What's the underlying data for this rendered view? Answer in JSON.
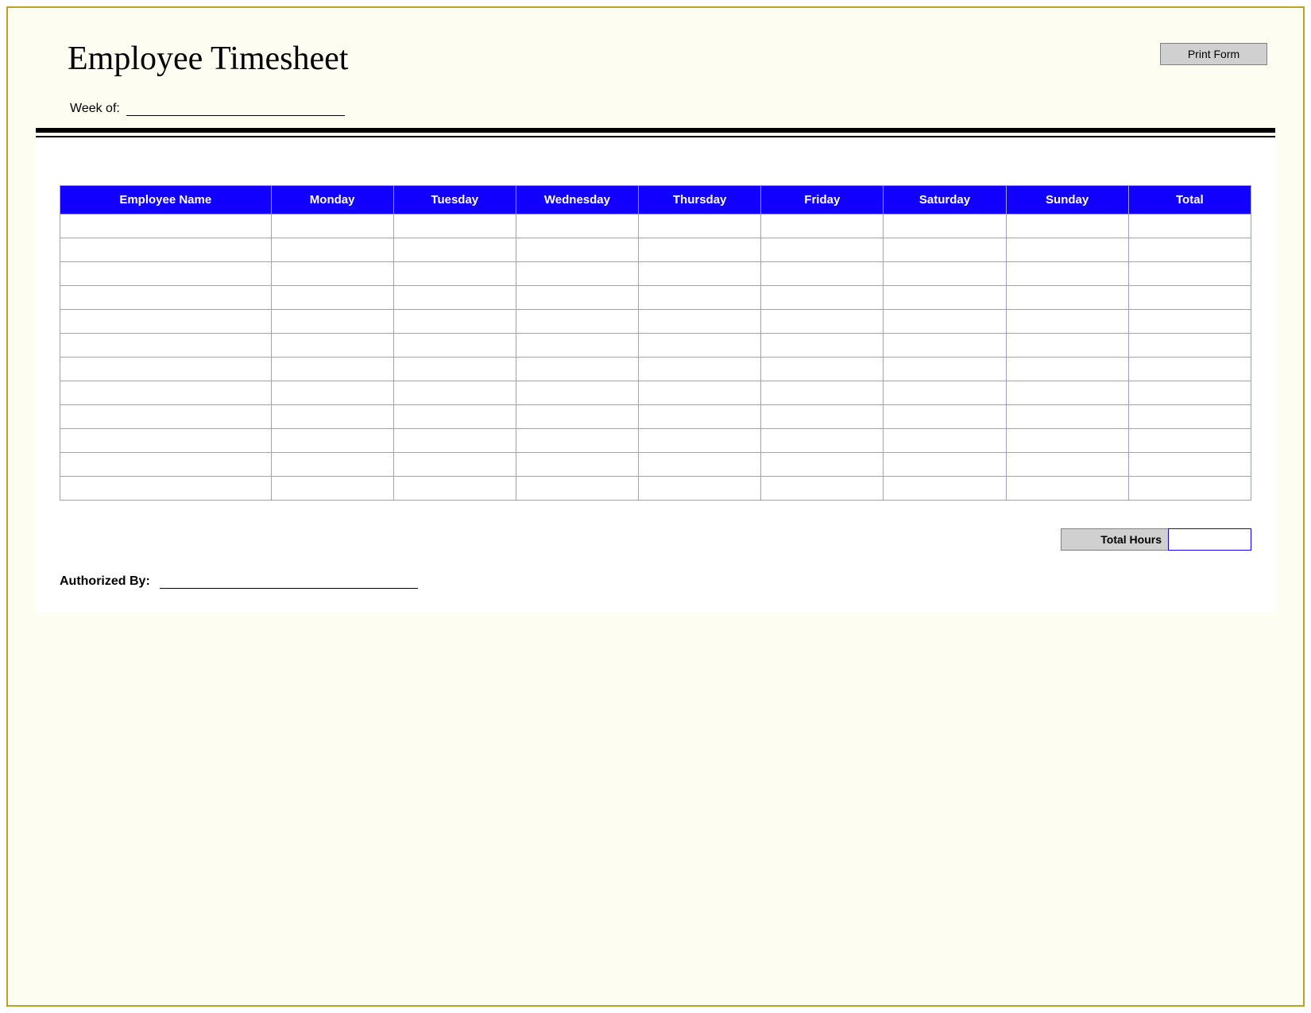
{
  "title": "Employee Timesheet",
  "print_button_label": "Print Form",
  "week_of_label": "Week of:",
  "week_of_value": "",
  "table": {
    "headers": [
      "Employee Name",
      "Monday",
      "Tuesday",
      "Wednesday",
      "Thursday",
      "Friday",
      "Saturday",
      "Sunday",
      "Total"
    ],
    "rows": [
      [
        "",
        "",
        "",
        "",
        "",
        "",
        "",
        "",
        ""
      ],
      [
        "",
        "",
        "",
        "",
        "",
        "",
        "",
        "",
        ""
      ],
      [
        "",
        "",
        "",
        "",
        "",
        "",
        "",
        "",
        ""
      ],
      [
        "",
        "",
        "",
        "",
        "",
        "",
        "",
        "",
        ""
      ],
      [
        "",
        "",
        "",
        "",
        "",
        "",
        "",
        "",
        ""
      ],
      [
        "",
        "",
        "",
        "",
        "",
        "",
        "",
        "",
        ""
      ],
      [
        "",
        "",
        "",
        "",
        "",
        "",
        "",
        "",
        ""
      ],
      [
        "",
        "",
        "",
        "",
        "",
        "",
        "",
        "",
        ""
      ],
      [
        "",
        "",
        "",
        "",
        "",
        "",
        "",
        "",
        ""
      ],
      [
        "",
        "",
        "",
        "",
        "",
        "",
        "",
        "",
        ""
      ],
      [
        "",
        "",
        "",
        "",
        "",
        "",
        "",
        "",
        ""
      ],
      [
        "",
        "",
        "",
        "",
        "",
        "",
        "",
        "",
        ""
      ]
    ]
  },
  "total_hours_label": "Total Hours",
  "total_hours_value": "",
  "authorized_by_label": "Authorized By:",
  "authorized_by_value": ""
}
